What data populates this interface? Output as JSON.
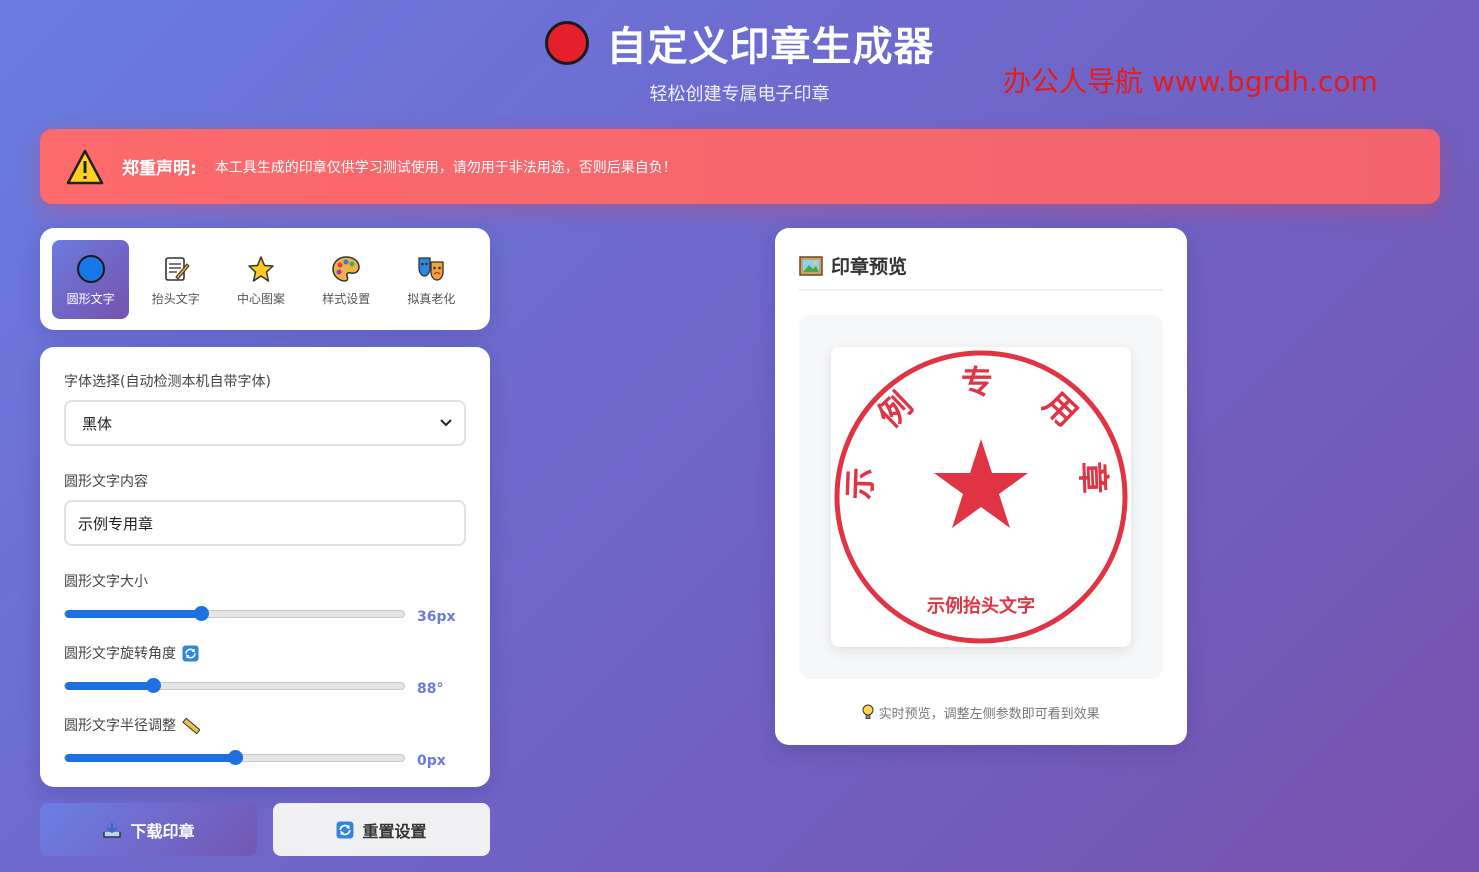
{
  "header": {
    "title": "自定义印章生成器",
    "subtitle": "轻松创建专属电子印章",
    "watermark": "办公人导航 www.bgrdh.com"
  },
  "warning": {
    "title": "郑重声明:",
    "text": "本工具生成的印章仅供学习测试使用，请勿用于非法用途，否则后果自负！"
  },
  "tabs": [
    {
      "label": "圆形文字",
      "icon": "circle-icon",
      "active": true
    },
    {
      "label": "抬头文字",
      "icon": "memo-icon",
      "active": false
    },
    {
      "label": "中心图案",
      "icon": "star-icon",
      "active": false
    },
    {
      "label": "样式设置",
      "icon": "palette-icon",
      "active": false
    },
    {
      "label": "拟真老化",
      "icon": "masks-icon",
      "active": false
    }
  ],
  "form": {
    "font_label": "字体选择(自动检测本机自带字体)",
    "font_value": "黑体",
    "text_label": "圆形文字内容",
    "text_value": "示例专用章",
    "size_label": "圆形文字大小",
    "size_value": "36px",
    "size_ratio": 0.4,
    "rotate_label": "圆形文字旋转角度",
    "rotate_value": "88°",
    "rotate_ratio": 0.26,
    "radius_label": "圆形文字半径调整",
    "radius_value": "0px",
    "radius_ratio": 0.5
  },
  "buttons": {
    "download": "下载印章",
    "reset": "重置设置"
  },
  "preview": {
    "title": "印章预览",
    "hint": "实时预览，调整左侧参数即可看到效果",
    "stamp_color": "#e03444",
    "circle_chars": [
      "示",
      "例",
      "专",
      "用",
      "章"
    ],
    "bottom_text": "示例抬头文字"
  }
}
